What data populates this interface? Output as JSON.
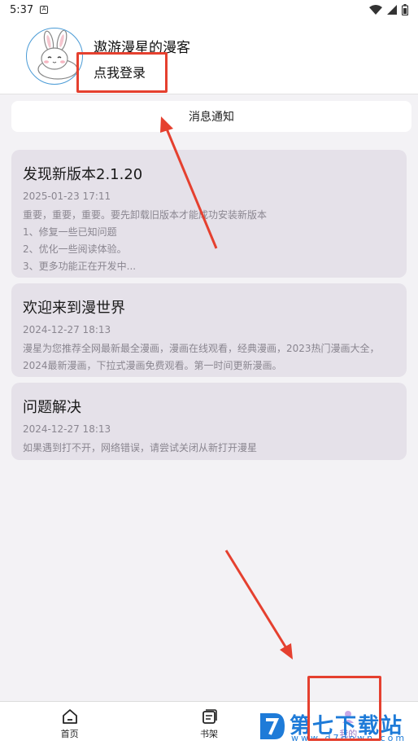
{
  "status_bar": {
    "time": "5:37",
    "notif_glyph": "A"
  },
  "profile": {
    "username": "遨游漫星的漫客",
    "login_label": "点我登录"
  },
  "notice": {
    "label": "消息通知"
  },
  "cards": [
    {
      "title": "发现新版本2.1.20",
      "date": "2025-01-23 17:11",
      "lines": [
        "重要，重要，重要。要先卸载旧版本才能成功安装新版本",
        "1、修复一些已知问题",
        "2、优化一些阅读体验。",
        "3、更多功能正在开发中..."
      ]
    },
    {
      "title": "欢迎来到漫世界",
      "date": "2024-12-27 18:13",
      "lines": [
        "漫星为您推荐全网最新最全漫画，漫画在线观看，经典漫画，2023热门漫画大全，",
        "2024最新漫画，下拉式漫画免费观看。第一时间更新漫画。"
      ]
    },
    {
      "title": "问题解决",
      "date": "2024-12-27 18:13",
      "lines": [
        "如果遇到打不开，网络错误，请尝试关闭从新打开漫星"
      ]
    }
  ],
  "bottom_nav": {
    "home": "首页",
    "shelf": "书架",
    "mine": "我的"
  },
  "watermark": {
    "text": "第七下载站",
    "url": "www.d7down.com"
  },
  "colors": {
    "annotation": "#e5402f",
    "accent": "#4a9bd6",
    "card_bg": "#e5e1e9",
    "watermark": "#1e7bd8"
  }
}
